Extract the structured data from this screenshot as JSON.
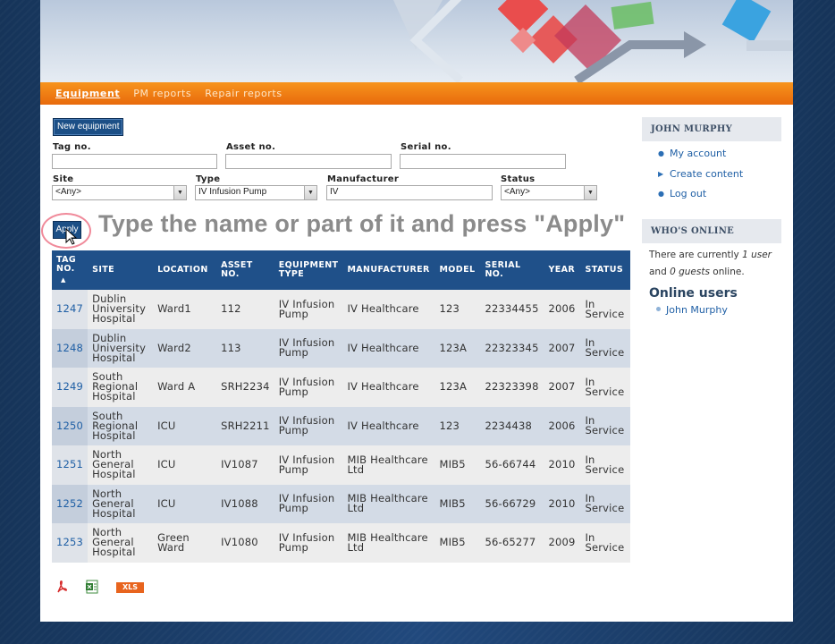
{
  "nav": {
    "items": [
      {
        "label": "Equipment",
        "active": true
      },
      {
        "label": "PM reports",
        "active": false
      },
      {
        "label": "Repair reports",
        "active": false
      }
    ]
  },
  "toolbar": {
    "new_equipment_label": "New equipment"
  },
  "filters": {
    "tag_label": "Tag no.",
    "asset_label": "Asset no.",
    "serial_label": "Serial no.",
    "tag_value": "",
    "asset_value": "",
    "serial_value": "",
    "site_label": "Site",
    "site_value": "<Any>",
    "type_label": "Type",
    "type_value": "IV Infusion Pump",
    "manufacturer_label": "Manufacturer",
    "manufacturer_value": "IV",
    "status_label": "Status",
    "status_value": "<Any>",
    "apply_label": "Apply"
  },
  "caption": "Type the name or part of it and press \"Apply\"",
  "table": {
    "columns": [
      "TAG NO.",
      "SITE",
      "LOCATION",
      "ASSET NO.",
      "EQUIPMENT TYPE",
      "MANUFACTURER",
      "MODEL",
      "SERIAL NO.",
      "YEAR",
      "STATUS"
    ],
    "column_lines": [
      [
        "TAG",
        "NO."
      ],
      [
        "SITE"
      ],
      [
        "LOCATION"
      ],
      [
        "ASSET",
        "NO."
      ],
      [
        "EQUIPMENT",
        "TYPE"
      ],
      [
        "MANUFACTURER"
      ],
      [
        "MODEL"
      ],
      [
        "SERIAL",
        "NO."
      ],
      [
        "YEAR"
      ],
      [
        "STATUS"
      ]
    ],
    "sort_indicator": "▲",
    "rows": [
      {
        "tag": "1247",
        "site": "Dublin University Hospital",
        "location": "Ward1",
        "asset": "112",
        "type": "IV Infusion Pump",
        "manufacturer": "IV Healthcare",
        "model": "123",
        "serial": "22334455",
        "year": "2006",
        "status": "In Service"
      },
      {
        "tag": "1248",
        "site": "Dublin University Hospital",
        "location": "Ward2",
        "asset": "113",
        "type": "IV Infusion Pump",
        "manufacturer": "IV Healthcare",
        "model": "123A",
        "serial": "22323345",
        "year": "2007",
        "status": "In Service"
      },
      {
        "tag": "1249",
        "site": "South Regional Hospital",
        "location": "Ward A",
        "asset": "SRH2234",
        "type": "IV Infusion Pump",
        "manufacturer": "IV Healthcare",
        "model": "123A",
        "serial": "22323398",
        "year": "2007",
        "status": "In Service"
      },
      {
        "tag": "1250",
        "site": "South Regional Hospital",
        "location": "ICU",
        "asset": "SRH2211",
        "type": "IV Infusion Pump",
        "manufacturer": "IV Healthcare",
        "model": "123",
        "serial": "2234438",
        "year": "2006",
        "status": "In Service"
      },
      {
        "tag": "1251",
        "site": "North General Hospital",
        "location": "ICU",
        "asset": "IV1087",
        "type": "IV Infusion Pump",
        "manufacturer": "MIB Healthcare Ltd",
        "model": "MIB5",
        "serial": "56-66744",
        "year": "2010",
        "status": "In Service"
      },
      {
        "tag": "1252",
        "site": "North General Hospital",
        "location": "ICU",
        "asset": "IV1088",
        "type": "IV Infusion Pump",
        "manufacturer": "MIB Healthcare Ltd",
        "model": "MIB5",
        "serial": "56-66729",
        "year": "2010",
        "status": "In Service"
      },
      {
        "tag": "1253",
        "site": "North General Hospital",
        "location": "Green Ward",
        "asset": "IV1080",
        "type": "IV Infusion Pump",
        "manufacturer": "MIB Healthcare Ltd",
        "model": "MIB5",
        "serial": "56-65277",
        "year": "2009",
        "status": "In Service"
      }
    ]
  },
  "export": {
    "xls_label": "XLS"
  },
  "sidebar": {
    "user_heading": "JOHN MURPHY",
    "user_links": [
      "My account",
      "Create content",
      "Log out"
    ],
    "online_heading": "WHO'S ONLINE",
    "online_text_prefix": "There are currently ",
    "online_users_count": "1 user",
    "online_text_mid": " and ",
    "online_guests_count": "0 guests",
    "online_text_suffix": " online.",
    "online_users_heading": "Online users",
    "online_users": [
      "John Murphy"
    ]
  },
  "colors": {
    "nav_orange": "#f7941d",
    "table_header": "#1f5089",
    "link_blue": "#1f5fa5",
    "background_navy": "#1c3e6c"
  }
}
